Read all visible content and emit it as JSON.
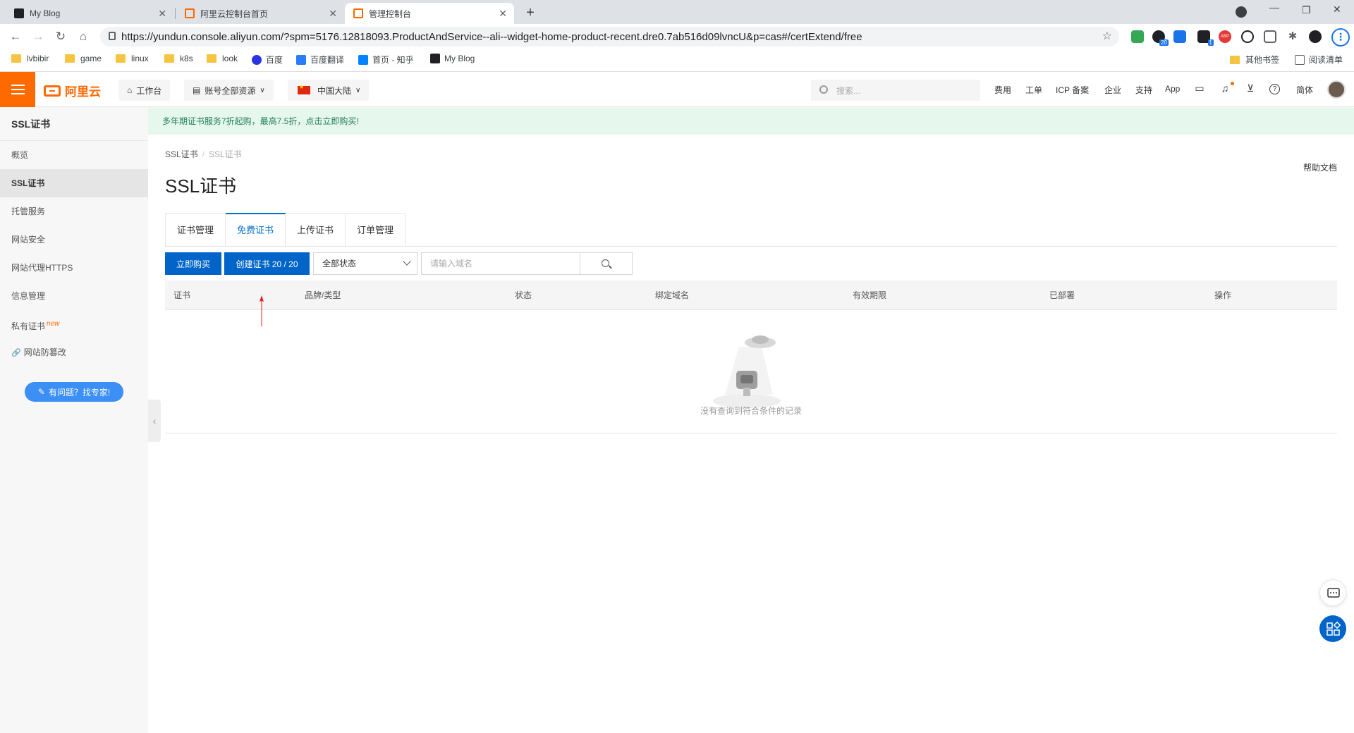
{
  "browser": {
    "tabs": [
      {
        "title": "My Blog"
      },
      {
        "title": "阿里云控制台首页"
      },
      {
        "title": "管理控制台"
      }
    ],
    "url": "https://yundun.console.aliyun.com/?spm=5176.12818093.ProductAndService--ali--widget-home-product-recent.dre0.7ab516d09lvncU&p=cas#/certExtend/free",
    "extension_badges": [
      "20",
      "1",
      "ABP"
    ],
    "bookmarks": [
      {
        "label": "lvbibir",
        "kind": "folder"
      },
      {
        "label": "game",
        "kind": "folder"
      },
      {
        "label": "linux",
        "kind": "folder"
      },
      {
        "label": "k8s",
        "kind": "folder"
      },
      {
        "label": "look",
        "kind": "folder"
      },
      {
        "label": "百度",
        "kind": "site"
      },
      {
        "label": "百度翻译",
        "kind": "site"
      },
      {
        "label": "首页 - 知乎",
        "kind": "site"
      },
      {
        "label": "My Blog",
        "kind": "site"
      }
    ],
    "bookmarks_right": {
      "other": "其他书签",
      "reading_list": "阅读清单"
    }
  },
  "topbar": {
    "logo": "阿里云",
    "workbench": "工作台",
    "resources": "账号全部资源",
    "region": "中国大陆",
    "search_placeholder": "搜索...",
    "links": [
      "费用",
      "工单",
      "ICP 备案",
      "企业",
      "支持",
      "App"
    ],
    "lang": "简体"
  },
  "sidebar": {
    "title": "SSL证书",
    "items": [
      {
        "label": "概览"
      },
      {
        "label": "SSL证书"
      },
      {
        "label": "托管服务"
      },
      {
        "label": "网站安全"
      },
      {
        "label": "网站代理HTTPS"
      },
      {
        "label": "信息管理"
      },
      {
        "label": "私有证书",
        "tag": "new"
      },
      {
        "label": "网站防篡改"
      }
    ],
    "help_button": "有问题？找专家!"
  },
  "main": {
    "banner": "多年期证书服务7折起购，最高7.5折，点击立即购买!",
    "breadcrumb": [
      "SSL证书",
      "SSL证书"
    ],
    "help_doc": "帮助文档",
    "title": "SSL证书",
    "tabs": [
      {
        "label": "证书管理"
      },
      {
        "label": "免费证书"
      },
      {
        "label": "上传证书"
      },
      {
        "label": "订单管理"
      }
    ],
    "buy_button": "立即购买",
    "create_button": "创建证书 20 / 20",
    "status_select": "全部状态",
    "domain_placeholder": "请输入域名",
    "columns": [
      "证书",
      "品牌/类型",
      "状态",
      "绑定域名",
      "有效期限",
      "已部署",
      "操作"
    ],
    "empty_text": "没有查询到符合条件的记录"
  },
  "colors": {
    "brand": "#ff6a00",
    "primary": "#0064c8",
    "banner_bg": "#e6f7ee",
    "arrow": "#e02020"
  }
}
